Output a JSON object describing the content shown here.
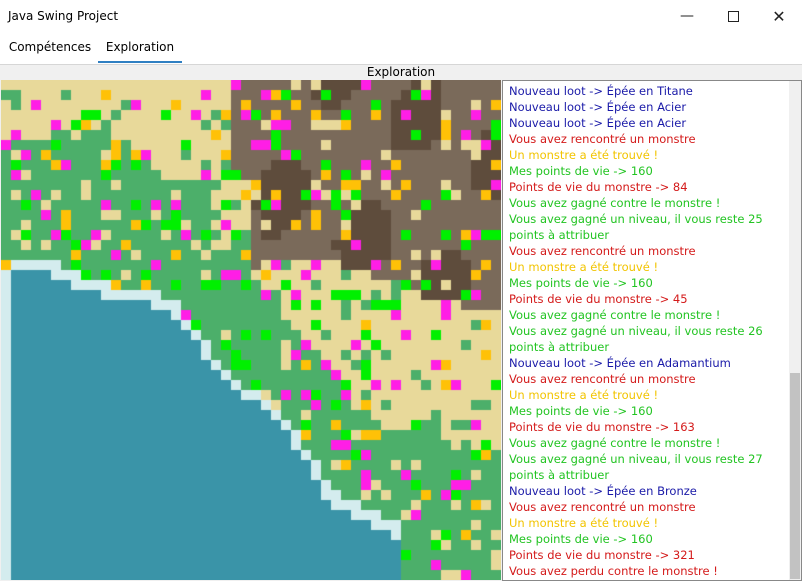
{
  "window": {
    "title": "Java Swing Project"
  },
  "tabs": [
    {
      "label": "Compétences",
      "active": false
    },
    {
      "label": "Exploration",
      "active": true
    }
  ],
  "panel": {
    "title": "Exploration"
  },
  "colors": {
    "loot": "#1a1aa8",
    "danger": "#d41a1a",
    "info_yellow": "#f2c400",
    "success": "#22c422",
    "accent": "#2f7fc2"
  },
  "log": [
    {
      "text": "Nouveau loot -> Épée en Titane",
      "kind": "loot"
    },
    {
      "text": "Nouveau loot -> Épée en Acier",
      "kind": "loot"
    },
    {
      "text": "Nouveau loot -> Épée en Acier",
      "kind": "loot"
    },
    {
      "text": "Vous avez rencontré un monstre",
      "kind": "danger"
    },
    {
      "text": "Un monstre a été trouvé !",
      "kind": "info_yellow"
    },
    {
      "text": "Mes points de vie -> 160",
      "kind": "success"
    },
    {
      "text": "Points de vie du monstre -> 84",
      "kind": "danger"
    },
    {
      "text": "Vous avez gagné contre le monstre !",
      "kind": "success"
    },
    {
      "text": "Vous avez gagné un niveau, il vous reste 25 points à attribuer",
      "kind": "success"
    },
    {
      "text": "Vous avez rencontré un monstre",
      "kind": "danger"
    },
    {
      "text": "Un monstre a été trouvé !",
      "kind": "info_yellow"
    },
    {
      "text": "Mes points de vie -> 160",
      "kind": "success"
    },
    {
      "text": "Points de vie du monstre -> 45",
      "kind": "danger"
    },
    {
      "text": "Vous avez gagné contre le monstre !",
      "kind": "success"
    },
    {
      "text": "Vous avez gagné un niveau, il vous reste 26 points à attribuer",
      "kind": "success"
    },
    {
      "text": "Nouveau loot -> Épée en Adamantium",
      "kind": "loot"
    },
    {
      "text": "Vous avez rencontré un monstre",
      "kind": "danger"
    },
    {
      "text": "Un monstre a été trouvé !",
      "kind": "info_yellow"
    },
    {
      "text": "Mes points de vie -> 160",
      "kind": "success"
    },
    {
      "text": "Points de vie du monstre -> 163",
      "kind": "danger"
    },
    {
      "text": "Vous avez gagné contre le monstre !",
      "kind": "success"
    },
    {
      "text": "Vous avez gagné un niveau, il vous reste 27 points à attribuer",
      "kind": "success"
    },
    {
      "text": "Nouveau loot -> Épée en Bronze",
      "kind": "loot"
    },
    {
      "text": "Vous avez rencontré un monstre",
      "kind": "danger"
    },
    {
      "text": "Un monstre a été trouvé !",
      "kind": "info_yellow"
    },
    {
      "text": "Mes points de vie -> 160",
      "kind": "success"
    },
    {
      "text": "Points de vie du monstre -> 321",
      "kind": "danger"
    },
    {
      "text": "Vous avez perdu contre le monstre !",
      "kind": "danger"
    }
  ],
  "map": {
    "terrain_colors": {
      "sand": "#e8d99a",
      "grass": "#4caf6a",
      "mountain": "#7a6a5a",
      "mountain_dark": "#5e4c3c",
      "water": "#3a94a8",
      "shore": "#d4ecee"
    },
    "marker_colors": [
      "#ffc107",
      "#ff1ee6",
      "#00f000"
    ]
  }
}
